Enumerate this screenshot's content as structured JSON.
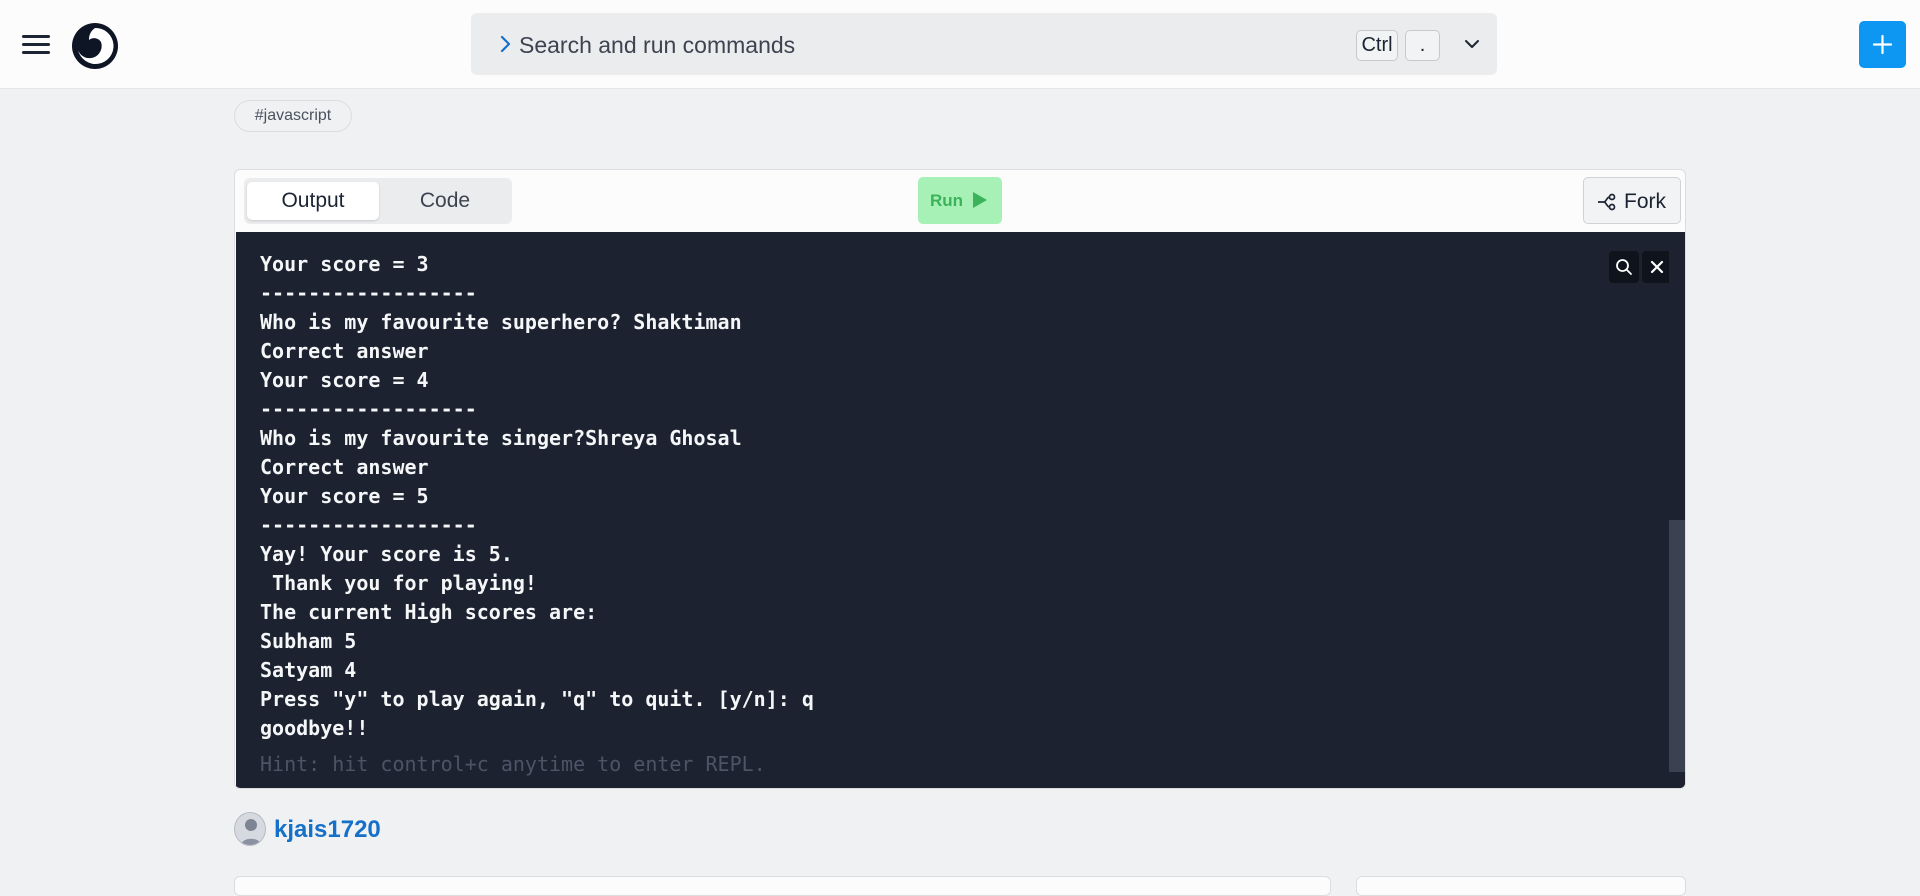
{
  "header": {
    "menu_icon": "hamburger-menu-icon",
    "logo_icon": "replit-logo-icon",
    "command_bar": {
      "placeholder": "Search and run commands",
      "shortcut_keys": [
        "Ctrl",
        "."
      ]
    },
    "new_repl_icon": "plus-icon"
  },
  "tags": [
    "#javascript"
  ],
  "repl": {
    "tabs": [
      {
        "label": "Output",
        "active": true
      },
      {
        "label": "Code",
        "active": false
      }
    ],
    "run_label": "Run",
    "fork_label": "Fork",
    "console": {
      "lines": [
        "Your score = 3",
        "------------------",
        "Who is my favourite superhero? Shaktiman",
        "Correct answer",
        "Your score = 4",
        "------------------",
        "Who is my favourite singer?Shreya Ghosal",
        "Correct answer",
        "Your score = 5",
        "------------------",
        "Yay! Your score is 5.",
        " Thank you for playing!",
        "The current High scores are:",
        "Subham 5",
        "Satyam 4",
        "Press \"y\" to play again, \"q\" to quit. [y/n]: q",
        "goodbye!!"
      ],
      "hint": "Hint: hit control+c anytime to enter REPL."
    }
  },
  "author": {
    "username": "kjais1720"
  },
  "colors": {
    "accent_blue": "#0d96f2",
    "run_green": "#a7f0b6",
    "console_bg": "#1c2230",
    "username_blue": "#1470c9"
  }
}
